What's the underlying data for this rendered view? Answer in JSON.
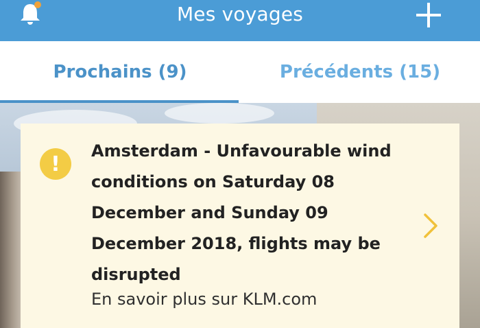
{
  "header": {
    "title": "Mes voyages",
    "bell_icon": "bell-icon",
    "add_icon": "plus-icon",
    "background_color": "#4b9cd6"
  },
  "tabs": [
    {
      "label": "Prochains (9)",
      "active": true
    },
    {
      "label": "Précédents (15)",
      "active": false
    }
  ],
  "alert": {
    "icon": "warning-icon",
    "message": "Amsterdam - Unfavourable wind conditions on Saturday 08 December and Sunday 09 December 2018, flights may be disrupted",
    "link": "En savoir plus sur KLM.com",
    "background_color": "#fdf8e4",
    "icon_color": "#f3cc45",
    "chevron_icon": "chevron-right-icon"
  }
}
